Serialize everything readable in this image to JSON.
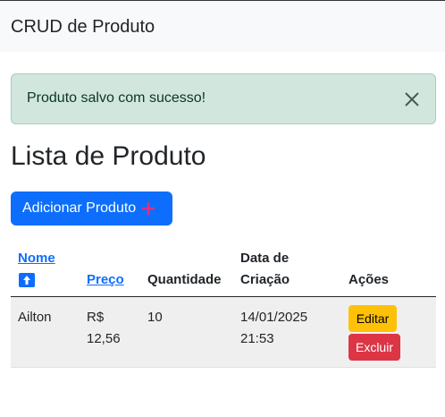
{
  "navbar": {
    "brand": "CRUD de Produto"
  },
  "alert": {
    "message": "Produto salvo com sucesso!"
  },
  "page": {
    "title": "Lista de Produto"
  },
  "actions": {
    "add_label": "Adicionar Produto"
  },
  "table": {
    "headers": {
      "nome": "Nome",
      "preco": "Preço",
      "quantidade": "Quantidade",
      "data_line1": "Data de",
      "data_line2": "Criação",
      "acoes": "Ações"
    },
    "rows": [
      {
        "nome": "Ailton",
        "preco_line1": "R$",
        "preco_line2": "12,56",
        "quantidade": "10",
        "data_line1": "14/01/2025",
        "data_line2": "21:53",
        "edit_label": "Editar",
        "delete_label": "Excluir"
      }
    ]
  },
  "colors": {
    "primary": "#0d6efd",
    "success_bg": "#d1e7dd",
    "warning": "#ffc107",
    "danger": "#dc3545"
  }
}
